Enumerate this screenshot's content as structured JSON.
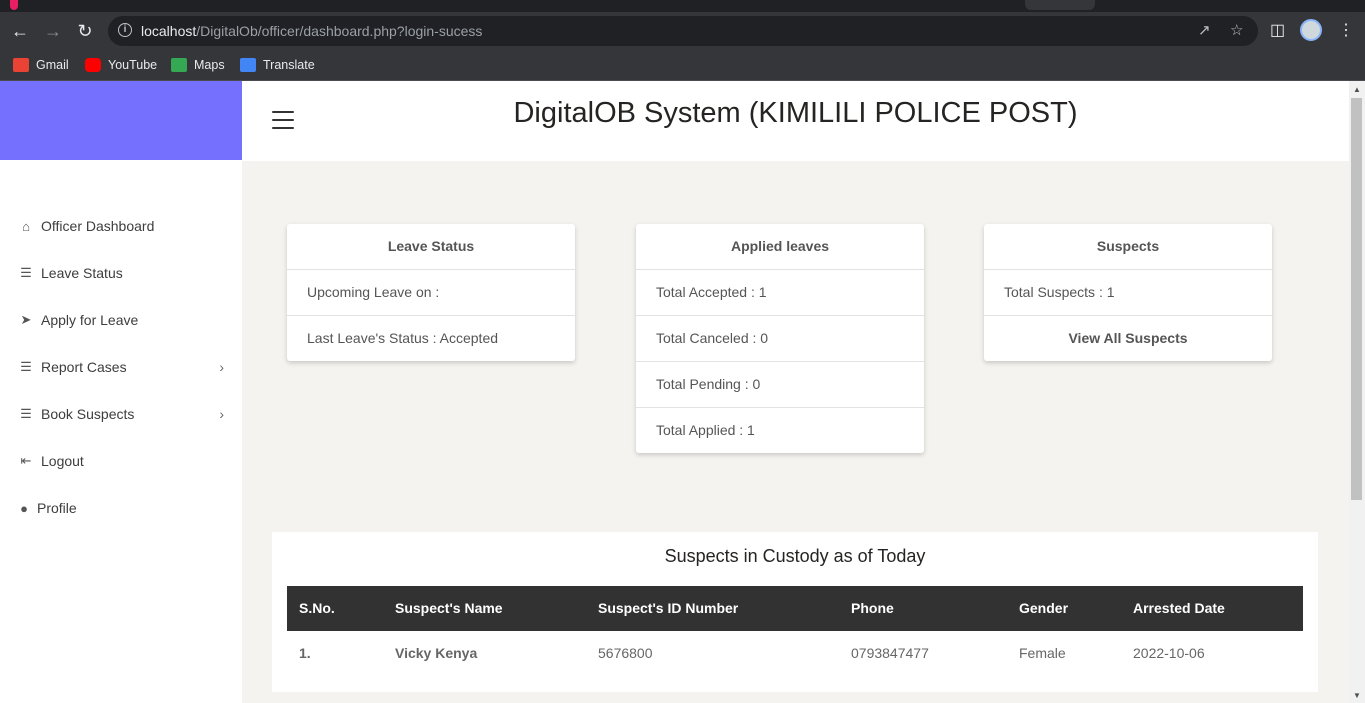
{
  "browser": {
    "url_host": "localhost",
    "url_path": "/DigitalOb/officer/dashboard.php?login-sucess",
    "bookmarks": [
      {
        "label": "Gmail",
        "icon": "gmail-icon"
      },
      {
        "label": "YouTube",
        "icon": "youtube-icon"
      },
      {
        "label": "Maps",
        "icon": "maps-icon"
      },
      {
        "label": "Translate",
        "icon": "translate-icon"
      }
    ]
  },
  "sidebar": {
    "items": [
      {
        "label": "Officer Dashboard",
        "icon": "home-icon"
      },
      {
        "label": "Leave Status",
        "icon": "list-icon"
      },
      {
        "label": "Apply for Leave",
        "icon": "paper-plane-icon"
      },
      {
        "label": "Report Cases",
        "icon": "list-icon",
        "submenu": true
      },
      {
        "label": "Book Suspects",
        "icon": "list-icon",
        "submenu": true
      },
      {
        "label": "Logout",
        "icon": "logout-icon"
      },
      {
        "label": "Profile",
        "icon": "user-icon"
      }
    ]
  },
  "header": {
    "title": "DigitalOB System (KIMILILI POLICE POST)"
  },
  "cards": {
    "leave_status": {
      "title": "Leave Status",
      "upcoming": "Upcoming Leave on :",
      "last_status": "Last Leave's Status : Accepted"
    },
    "applied_leaves": {
      "title": "Applied leaves",
      "accepted": "Total Accepted : 1",
      "canceled": "Total Canceled : 0",
      "pending": "Total Pending : 0",
      "applied": "Total Applied : 1"
    },
    "suspects": {
      "title": "Suspects",
      "total": "Total Suspects : 1",
      "view_all": "View All Suspects"
    }
  },
  "table": {
    "title": "Suspects in Custody as of Today",
    "headers": [
      "S.No.",
      "Suspect's Name",
      "Suspect's ID Number",
      "Phone",
      "Gender",
      "Arrested Date"
    ],
    "rows": [
      [
        "1.",
        "Vicky Kenya",
        "5676800",
        "0793847477",
        "Female",
        "2022-10-06"
      ]
    ]
  },
  "colors": {
    "brand": "#7670ff",
    "table_header": "#323232",
    "page_bg": "#f4f3ef"
  }
}
